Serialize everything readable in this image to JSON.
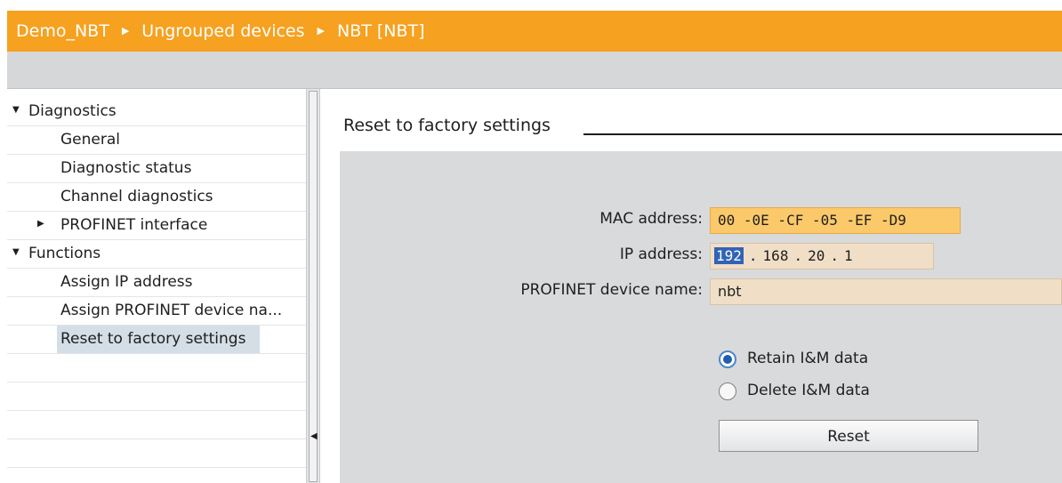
{
  "breadcrumb": {
    "items": [
      "Demo_NBT",
      "Ungrouped devices",
      "NBT [NBT]"
    ],
    "separator": "▶"
  },
  "nav": {
    "groups": [
      {
        "label": "Diagnostics",
        "expanded": true,
        "items": [
          {
            "label": "General"
          },
          {
            "label": "Diagnostic status"
          },
          {
            "label": "Channel diagnostics"
          },
          {
            "label": "PROFINET interface",
            "expandable": true
          }
        ]
      },
      {
        "label": "Functions",
        "expanded": true,
        "items": [
          {
            "label": "Assign IP address"
          },
          {
            "label": "Assign PROFINET device na..."
          },
          {
            "label": "Reset to factory settings",
            "selected": true
          }
        ]
      }
    ]
  },
  "main": {
    "section_title": "Reset to factory settings",
    "mac": {
      "label": "MAC address:",
      "value": "00 -0E -CF -05 -EF -D9"
    },
    "ip": {
      "label": "IP address:",
      "octets": [
        "192",
        "168",
        "20",
        "1"
      ]
    },
    "device_name": {
      "label": "PROFINET device name:",
      "value": "nbt"
    },
    "options": {
      "retain": {
        "label": "Retain I&M data",
        "checked": true
      },
      "delete": {
        "label": "Delete I&M data",
        "checked": false
      }
    },
    "reset_button": "Reset"
  },
  "colors": {
    "breadcrumb_bar": "#f6a11f",
    "mac_field": "#fcc96a",
    "input_field": "#f1dec7",
    "selection": "#3163b6"
  },
  "icons": {
    "expanded": "triangle-down-icon",
    "collapsed": "triangle-right-icon",
    "separator": "chevron-right-icon"
  }
}
